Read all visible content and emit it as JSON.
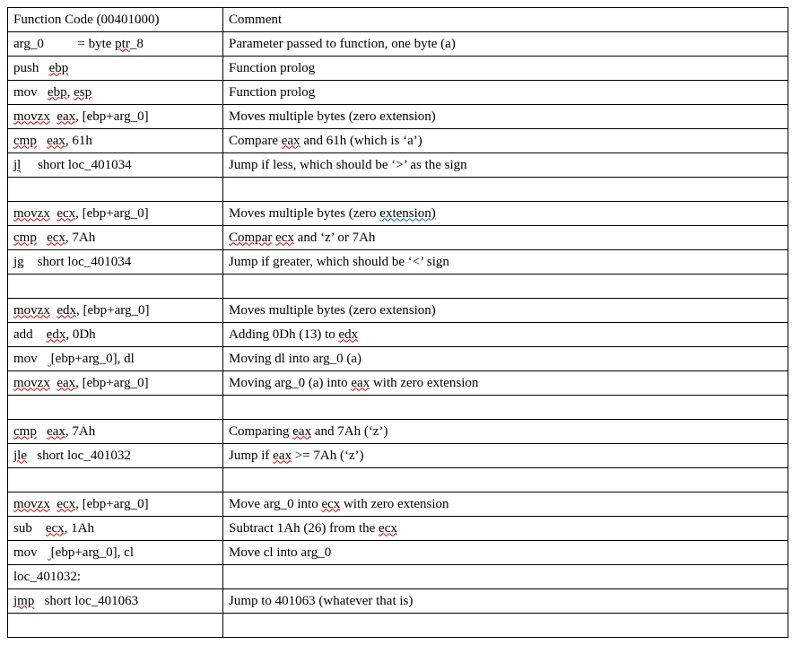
{
  "header": {
    "col1": "Function Code (00401000)",
    "col2": "Comment"
  },
  "rows": [
    {
      "code": [
        {
          "t": "arg_0          = byte "
        },
        {
          "t": "ptr",
          "cls": "sq"
        },
        {
          "t": "_8"
        }
      ],
      "comment": [
        {
          "t": "Parameter passed to function, one byte (a)"
        }
      ]
    },
    {
      "code": [
        {
          "t": "push   "
        },
        {
          "t": "ebp",
          "cls": "sq"
        }
      ],
      "comment": [
        {
          "t": "Function prolog"
        }
      ]
    },
    {
      "code": [
        {
          "t": "mov   "
        },
        {
          "t": "ebp",
          "cls": "sq"
        },
        {
          "t": ", "
        },
        {
          "t": "esp",
          "cls": "sq"
        }
      ],
      "comment": [
        {
          "t": "Function prolog"
        }
      ]
    },
    {
      "code": [
        {
          "t": "movzx",
          "cls": "sq"
        },
        {
          "t": "  "
        },
        {
          "t": "eax",
          "cls": "sq"
        },
        {
          "t": ", [ebp+arg_0]"
        }
      ],
      "comment": [
        {
          "t": "Moves multiple bytes (zero extension)"
        }
      ]
    },
    {
      "code": [
        {
          "t": "cmp",
          "cls": "sq"
        },
        {
          "t": "   "
        },
        {
          "t": "eax",
          "cls": "sq"
        },
        {
          "t": ", 61h"
        }
      ],
      "comment": [
        {
          "t": "Compare "
        },
        {
          "t": "eax",
          "cls": "sq"
        },
        {
          "t": " and 61h (which is ‘a’)"
        }
      ]
    },
    {
      "code": [
        {
          "t": "jl",
          "cls": "sq"
        },
        {
          "t": "     short loc_401034"
        }
      ],
      "comment": [
        {
          "t": "Jump if less, which should be ‘>’ as the sign"
        }
      ]
    },
    {
      "code": [],
      "comment": []
    },
    {
      "code": [
        {
          "t": "movzx",
          "cls": "sq"
        },
        {
          "t": "  "
        },
        {
          "t": "ecx",
          "cls": "sq"
        },
        {
          "t": ", [ebp+arg_0]"
        }
      ],
      "comment": [
        {
          "t": "Moves multiple bytes (zero "
        },
        {
          "t": "extension)",
          "cls": "sqb"
        },
        {
          "t": "   "
        }
      ]
    },
    {
      "code": [
        {
          "t": "cmp",
          "cls": "sq"
        },
        {
          "t": "   "
        },
        {
          "t": "ecx",
          "cls": "sq"
        },
        {
          "t": ", 7Ah"
        }
      ],
      "comment": [
        {
          "t": "Compar",
          "cls": "sq"
        },
        {
          "t": " "
        },
        {
          "t": "ecx",
          "cls": "sq"
        },
        {
          "t": " and ‘z’ or 7Ah"
        }
      ]
    },
    {
      "code": [
        {
          "t": "jg",
          "cls": "sq"
        },
        {
          "t": "    short loc_401034"
        }
      ],
      "comment": [
        {
          "t": "Jump if greater, which should be ‘<’ sign"
        }
      ]
    },
    {
      "code": [],
      "comment": []
    },
    {
      "code": [
        {
          "t": "movzx",
          "cls": "sq"
        },
        {
          "t": "  "
        },
        {
          "t": "edx",
          "cls": "sq"
        },
        {
          "t": ", [ebp+arg_0]"
        }
      ],
      "comment": [
        {
          "t": "Moves multiple bytes (zero extension)"
        }
      ]
    },
    {
      "code": [
        {
          "t": "add    "
        },
        {
          "t": "edx",
          "cls": "sq"
        },
        {
          "t": ", 0Dh"
        }
      ],
      "comment": [
        {
          "t": "Adding 0Dh (13) to "
        },
        {
          "t": "edx",
          "cls": "sq"
        }
      ]
    },
    {
      "code": [
        {
          "t": "mov   "
        },
        {
          "t": " [",
          "cls": "sqb"
        },
        {
          "t": "ebp+arg_0], dl"
        }
      ],
      "comment": [
        {
          "t": "Moving dl into arg_0 (a)"
        }
      ]
    },
    {
      "code": [
        {
          "t": "movzx",
          "cls": "sq"
        },
        {
          "t": "  "
        },
        {
          "t": "eax",
          "cls": "sq"
        },
        {
          "t": ", [ebp+arg_0]"
        }
      ],
      "comment": [
        {
          "t": "Moving arg_0 (a) into "
        },
        {
          "t": "eax",
          "cls": "sq"
        },
        {
          "t": " with zero extension"
        }
      ]
    },
    {
      "code": [],
      "comment": []
    },
    {
      "code": [
        {
          "t": "cmp",
          "cls": "sq"
        },
        {
          "t": "   "
        },
        {
          "t": "eax",
          "cls": "sq"
        },
        {
          "t": ", 7Ah"
        }
      ],
      "comment": [
        {
          "t": "Comparing "
        },
        {
          "t": "eax",
          "cls": "sq"
        },
        {
          "t": " and 7Ah (‘z’)"
        }
      ]
    },
    {
      "code": [
        {
          "t": "jle",
          "cls": "sq"
        },
        {
          "t": "   short loc_401032"
        }
      ],
      "comment": [
        {
          "t": "Jump if "
        },
        {
          "t": "eax",
          "cls": "sq"
        },
        {
          "t": " >= 7Ah (‘z’)"
        }
      ]
    },
    {
      "code": [],
      "comment": []
    },
    {
      "code": [
        {
          "t": "movzx",
          "cls": "sq"
        },
        {
          "t": "  "
        },
        {
          "t": "ecx",
          "cls": "sq"
        },
        {
          "t": ", [ebp+arg_0]"
        }
      ],
      "comment": [
        {
          "t": "Move arg_0 into "
        },
        {
          "t": "ecx",
          "cls": "sq"
        },
        {
          "t": " with zero extension"
        }
      ]
    },
    {
      "code": [
        {
          "t": "sub    "
        },
        {
          "t": "ecx",
          "cls": "sq"
        },
        {
          "t": ", 1Ah"
        }
      ],
      "comment": [
        {
          "t": "Subtract 1Ah (26) from the "
        },
        {
          "t": "ecx",
          "cls": "sq"
        }
      ]
    },
    {
      "code": [
        {
          "t": "mov   "
        },
        {
          "t": " [",
          "cls": "sqb"
        },
        {
          "t": "ebp+arg_0], cl"
        }
      ],
      "comment": [
        {
          "t": "Move cl into arg_0"
        }
      ]
    },
    {
      "code": [
        {
          "t": "loc_401032:"
        }
      ],
      "comment": []
    },
    {
      "code": [
        {
          "t": "jmp",
          "cls": "sq"
        },
        {
          "t": "   short loc_401063"
        }
      ],
      "comment": [
        {
          "t": "Jump to 401063 (whatever that is)"
        }
      ]
    },
    {
      "code": [],
      "comment": []
    }
  ]
}
